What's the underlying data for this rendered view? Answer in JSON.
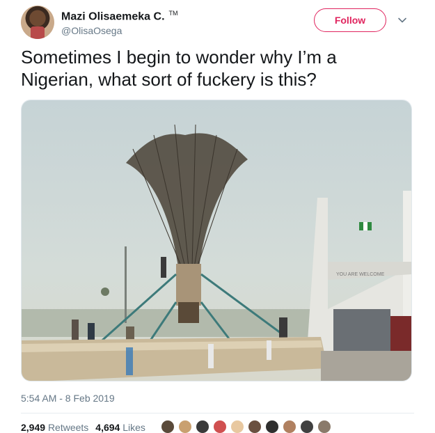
{
  "author": {
    "name": "Mazi Olisaemeka C.",
    "trademark": "TM",
    "handle": "@OlisaOsega"
  },
  "follow_label": "Follow",
  "tweet": {
    "text": "Sometimes I begin to wonder why I’m a Nigerian, what sort of fuckery is this?"
  },
  "photo": {
    "sign_text": "YOU ARE WELCOME"
  },
  "timestamp": "5:54 AM - 8 Feb 2019",
  "stats": {
    "retweets_count": "2,949",
    "retweets_label": "Retweets",
    "likes_count": "4,694",
    "likes_label": "Likes"
  },
  "likers": [
    {
      "color": "#5a4a3a"
    },
    {
      "color": "#c9a070"
    },
    {
      "color": "#3a3a3a"
    },
    {
      "color": "#d05050"
    },
    {
      "color": "#e8c8a0"
    },
    {
      "color": "#6a5040"
    },
    {
      "color": "#2f2f2f"
    },
    {
      "color": "#b08060"
    },
    {
      "color": "#404040"
    },
    {
      "color": "#8a7a6a"
    }
  ]
}
